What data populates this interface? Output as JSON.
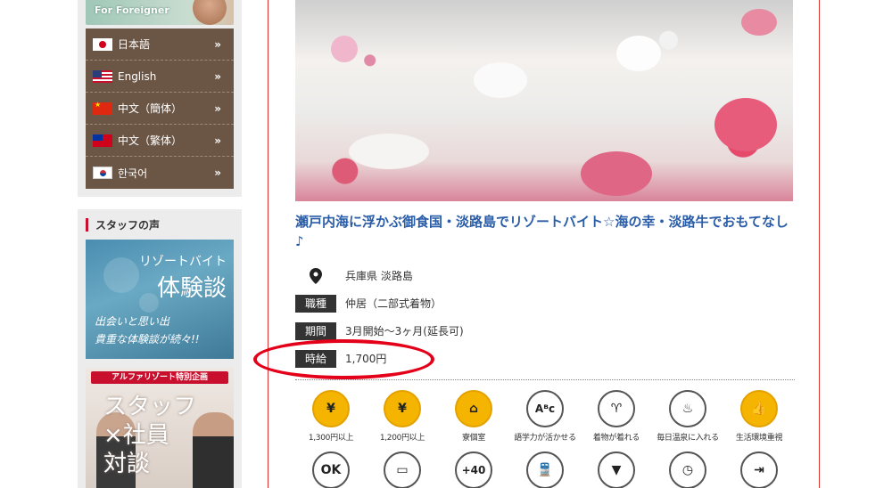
{
  "sidebar": {
    "foreigner_banner": "For Foreigner",
    "languages": [
      {
        "label": "日本語",
        "flag": "jp"
      },
      {
        "label": "English",
        "flag": "us"
      },
      {
        "label": "中文（簡体）",
        "flag": "cn"
      },
      {
        "label": "中文（繁体）",
        "flag": "tw"
      },
      {
        "label": "한국어",
        "flag": "kr"
      }
    ],
    "chevron": "»",
    "voice_title": "スタッフの声",
    "taiken_banner": {
      "line1": "リゾートバイト",
      "line2": "体験談",
      "line3": "出会いと思い出",
      "line4": "貴重な体験談が続々!!"
    },
    "taidan_banner": {
      "tag": "アルファリゾート特別企画",
      "line1": "スタッフ",
      "line2": "×社員",
      "line3": "対談"
    }
  },
  "job": {
    "title": "瀬戸内海に浮かぶ御食国・淡路島でリゾートバイト☆海の幸・淡路牛でおもてなし♪",
    "location": "兵庫県 淡路島",
    "rows": [
      {
        "label": "職種",
        "value": "仲居（二部式着物）"
      },
      {
        "label": "期間",
        "value": "3月開始～3ヶ月(延長可)"
      },
      {
        "label": "時給",
        "value": "1,700円"
      }
    ],
    "features_row1": [
      {
        "glyph": "¥",
        "label": "1,300円以上",
        "style": "yellow",
        "icon": "yen-icon"
      },
      {
        "glyph": "¥",
        "label": "1,200円以上",
        "style": "yellow",
        "icon": "yen-icon"
      },
      {
        "glyph": "⌂",
        "label": "寮個室",
        "style": "yellow",
        "icon": "house-icon"
      },
      {
        "glyph": "Aᴮc",
        "label": "語学力が活かせる",
        "style": "white",
        "icon": "language-icon"
      },
      {
        "glyph": "♈",
        "label": "着物が着れる",
        "style": "white",
        "icon": "kimono-icon"
      },
      {
        "glyph": "♨",
        "label": "毎日温泉に入れる",
        "style": "white",
        "icon": "hot-spring-icon"
      },
      {
        "glyph": "👍",
        "label": "生活環境重視",
        "style": "yellow",
        "icon": "thumbs-up-icon"
      }
    ],
    "features_row2": [
      {
        "glyph": "OK",
        "icon": "ok-couple-icon"
      },
      {
        "glyph": "▭",
        "icon": "monitor-icon"
      },
      {
        "glyph": "+40",
        "icon": "age-40-icon"
      },
      {
        "glyph": "🚆",
        "icon": "train-icon"
      },
      {
        "glyph": "▼",
        "icon": "necktie-icon"
      },
      {
        "glyph": "◷",
        "icon": "clock-icon"
      },
      {
        "glyph": "⇥",
        "icon": "exit-icon"
      }
    ]
  }
}
